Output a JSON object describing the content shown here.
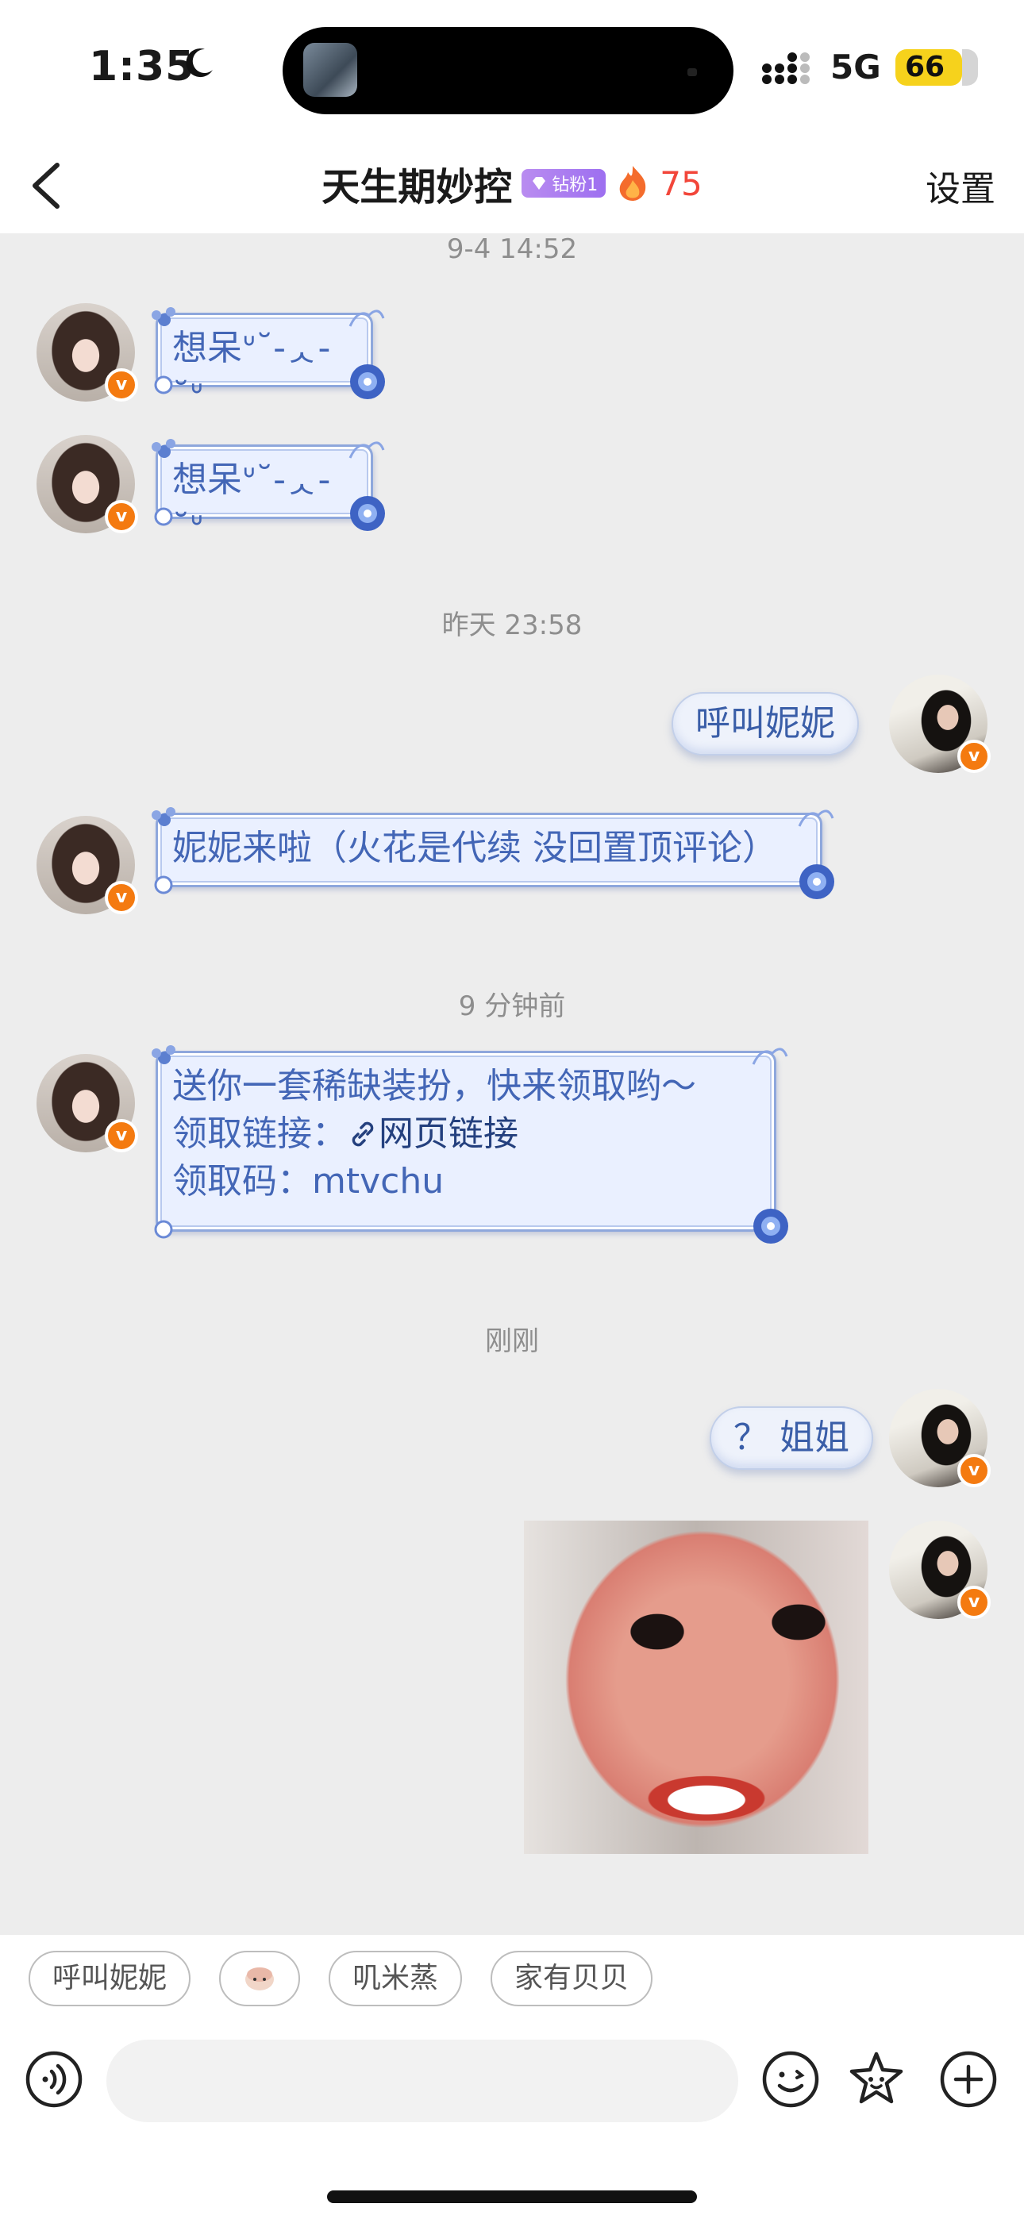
{
  "status_bar": {
    "time": "1:35",
    "network": "5G",
    "battery": "66"
  },
  "header": {
    "title": "天生期妙控",
    "fan_badge": "钻粉1",
    "spark_count": "75",
    "settings_label": "设置"
  },
  "timestamps": [
    "9-4 14:52",
    "昨天 23:58",
    "9 分钟前",
    "刚刚"
  ],
  "messages": [
    {
      "side": "left",
      "text": "想呆ᐡ˘-ᆺ-˘ᐡ"
    },
    {
      "side": "left",
      "text": "想呆ᐡ˘-ᆺ-˘ᐡ"
    },
    {
      "side": "right",
      "text": "呼叫妮妮"
    },
    {
      "side": "left",
      "text": "妮妮来啦（火花是代续 没回置顶评论）"
    },
    {
      "side": "left",
      "line1": "送你一套稀缺装扮，快来领取哟～",
      "line2_label": "领取链接：",
      "link_text": "网页链接",
      "line3": "领取码：mtvchu"
    },
    {
      "side": "right",
      "text": "？ 姐姐"
    },
    {
      "side": "right",
      "type": "image"
    }
  ],
  "quick_replies": [
    "呼叫妮妮",
    "",
    "叽米蒸",
    "家有贝贝"
  ],
  "input": {
    "placeholder": ""
  }
}
